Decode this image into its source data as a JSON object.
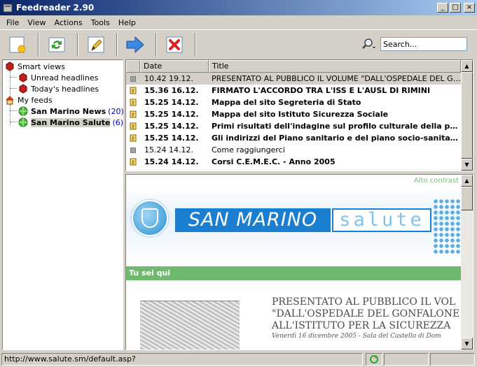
{
  "window": {
    "title": "Feedreader 2.90",
    "minimize": "_",
    "maximize": "□",
    "close": "×"
  },
  "menu": [
    "File",
    "View",
    "Actions",
    "Tools",
    "Help"
  ],
  "toolbar": {
    "buttons": [
      {
        "name": "new-feed-icon"
      },
      {
        "name": "refresh-icon"
      },
      {
        "name": "edit-icon"
      },
      {
        "name": "forward-arrow-icon"
      },
      {
        "name": "delete-icon"
      }
    ],
    "search_placeholder": "Search...",
    "search_value": "Search..."
  },
  "tree": {
    "smart_views": "Smart views",
    "unread": "Unread headlines",
    "today": "Today's headlines",
    "my_feeds": "My feeds",
    "feed1_name": "San Marino News",
    "feed1_count": "(20)",
    "feed2_name": "San Marino Salute",
    "feed2_count": "(6)"
  },
  "list": {
    "col_date": "Date",
    "col_title": "Title",
    "rows": [
      {
        "date": "10.42 19.12.",
        "title": "PRESENTATO AL PUBBLICO IL VOLUME \"DALL'OSPEDALE DEL GON...",
        "unread": false,
        "selected": true
      },
      {
        "date": "15.36 16.12.",
        "title": "FIRMATO L'ACCORDO TRA L'ISS E L'AUSL DI RIMINI",
        "unread": true,
        "selected": false
      },
      {
        "date": "15.25 14.12.",
        "title": "Mappa del sito Segreteria di Stato",
        "unread": true,
        "selected": false
      },
      {
        "date": "15.25 14.12.",
        "title": "Mappa del sito Istituto Sicurezza Sociale",
        "unread": true,
        "selected": false
      },
      {
        "date": "15.25 14.12.",
        "title": "Primi risultati dell'indagine sul profilo culturale della pop...",
        "unread": true,
        "selected": false
      },
      {
        "date": "15.25 14.12.",
        "title": "Gli indirizzi del Piano sanitario e del piano socio-sanitario",
        "unread": true,
        "selected": false
      },
      {
        "date": "15.24 14.12.",
        "title": "Come raggiungerci",
        "unread": false,
        "selected": false
      },
      {
        "date": "15.24 14.12.",
        "title": "Corsi C.E.M.E.C. - Anno 2005",
        "unread": true,
        "selected": false
      }
    ]
  },
  "browser": {
    "alto_contrast": "Alto contrast",
    "logo_left": "SAN MARINO",
    "logo_right": "salute",
    "breadcrumb": "Tu sei qui",
    "article_line1": "PRESENTATO AL PUBBLICO IL VOL",
    "article_line2": "\"DALL'OSPEDALE DEL GONFALONE",
    "article_line3": "ALL'ISTITUTO PER LA SICUREZZA",
    "article_sub": "Venerdì 16 dicembre 2005 - Sala del Castello di Dom"
  },
  "status": {
    "url": "http://www.salute.sm/default.asp?"
  },
  "colors": {
    "titlebar_start": "#0a246a",
    "titlebar_end": "#a6caf0",
    "accent_green": "#6fb96f",
    "brand_blue": "#1a7fd0"
  }
}
